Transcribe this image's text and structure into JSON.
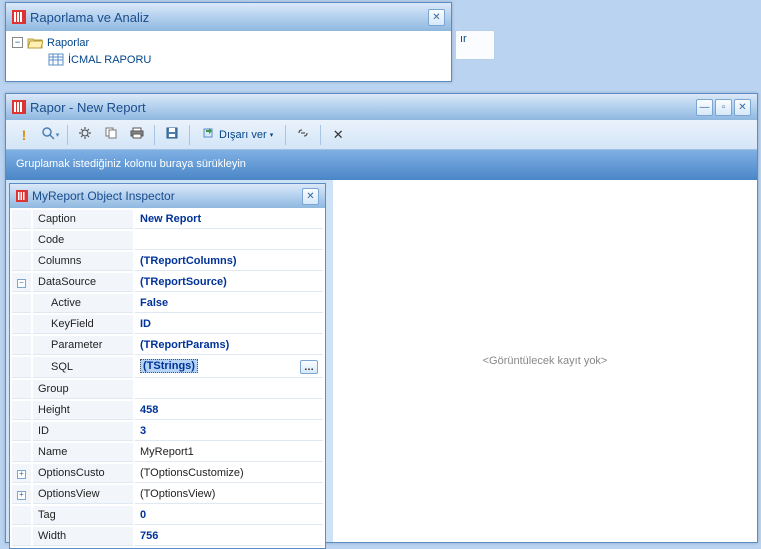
{
  "win_raporlama": {
    "title": "Raporlama ve Analiz",
    "tree": {
      "root": "Raporlar",
      "child": "İCMAL RAPORU"
    }
  },
  "edge_btn": "ır",
  "win_rapor": {
    "title": "Rapor - New Report",
    "toolbar": {
      "export_label": "Dışarı ver"
    },
    "group_hint": "Gruplamak istediğiniz kolonu buraya sürükleyin",
    "empty_text": "<Görüntülecek kayıt yok>"
  },
  "inspector": {
    "title": "MyReport Object Inspector",
    "rows": {
      "caption": {
        "label": "Caption",
        "value": "New Report"
      },
      "code": {
        "label": "Code",
        "value": ""
      },
      "columns": {
        "label": "Columns",
        "value": "(TReportColumns)"
      },
      "datasource": {
        "label": "DataSource",
        "value": "(TReportSource)"
      },
      "active": {
        "label": "Active",
        "value": "False"
      },
      "keyfield": {
        "label": "KeyField",
        "value": "ID"
      },
      "parameter": {
        "label": "Parameter",
        "value": "(TReportParams)"
      },
      "sql": {
        "label": "SQL",
        "value": "(TStrings)"
      },
      "group": {
        "label": "Group",
        "value": ""
      },
      "height": {
        "label": "Height",
        "value": "458"
      },
      "id": {
        "label": "ID",
        "value": "3"
      },
      "name": {
        "label": "Name",
        "value": "MyReport1"
      },
      "optionscusto": {
        "label": "OptionsCusto",
        "value": "(TOptionsCustomize)"
      },
      "optionsview": {
        "label": "OptionsView",
        "value": "(TOptionsView)"
      },
      "tag": {
        "label": "Tag",
        "value": "0"
      },
      "width": {
        "label": "Width",
        "value": "756"
      }
    }
  }
}
